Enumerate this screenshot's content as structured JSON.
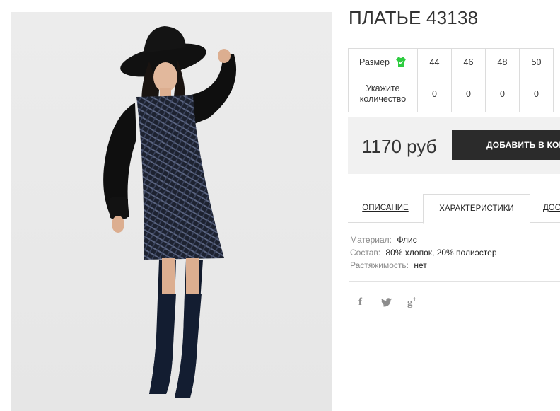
{
  "product": {
    "title": "ПЛАТЬЕ 43138",
    "price": "1170 руб",
    "image_alt": "product-photo"
  },
  "sizes": {
    "header_label": "Размер",
    "quantity_label": "Укажите количество",
    "columns": [
      {
        "size": "44",
        "qty": "0"
      },
      {
        "size": "46",
        "qty": "0"
      },
      {
        "size": "48",
        "qty": "0"
      },
      {
        "size": "50",
        "qty": "0"
      }
    ]
  },
  "cart": {
    "button_label": "ДОБАВИТЬ В КОРЗИНУ",
    "icon": "shopping-bag-icon"
  },
  "tabs": [
    {
      "label": "ОПИСАНИЕ",
      "active": false
    },
    {
      "label": "ХАРАКТЕРИСТИКИ",
      "active": true
    },
    {
      "label": "ДОСТАВКА",
      "active": false
    }
  ],
  "characteristics": [
    {
      "key": "Материал:",
      "value": "Флис"
    },
    {
      "key": "Состав:",
      "value": "80% хлопок, 20% полиэстер"
    },
    {
      "key": "Растяжимость:",
      "value": "нет"
    }
  ],
  "social": [
    {
      "name": "facebook",
      "icon": "facebook-icon",
      "glyph": "f"
    },
    {
      "name": "twitter",
      "icon": "twitter-icon"
    },
    {
      "name": "google-plus",
      "icon": "google-plus-icon",
      "glyph": "g",
      "plus": "+"
    }
  ],
  "colors": {
    "button_bg": "#2b2b2b",
    "price_panel_bg": "#f1f1f1",
    "size_icon_green": "#2ecc40",
    "muted_text": "#8a8a8a"
  }
}
